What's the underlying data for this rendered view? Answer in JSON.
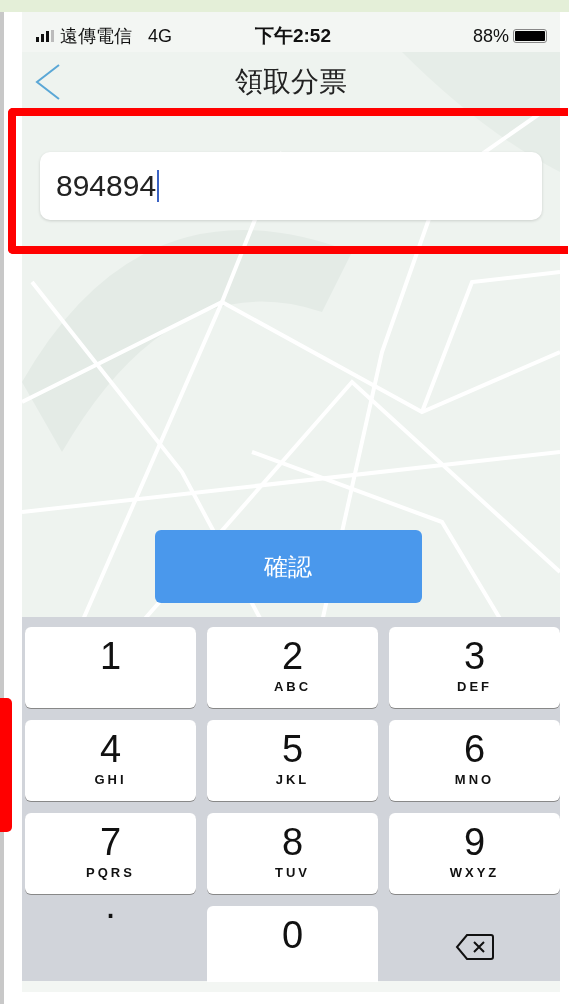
{
  "status_bar": {
    "carrier": "遠傳電信",
    "network": "4G",
    "time": "下午2:52",
    "battery": "88%"
  },
  "nav": {
    "title": "領取分票"
  },
  "field": {
    "value": "894894",
    "focused": true
  },
  "confirm_button": {
    "label": "確認"
  },
  "keypad": {
    "keys": [
      {
        "kind": "digit",
        "digit": "1"
      },
      {
        "kind": "digit",
        "digit": "2",
        "letters": "ABC"
      },
      {
        "kind": "digit",
        "digit": "3",
        "letters": "DEF"
      },
      {
        "kind": "digit",
        "digit": "4",
        "letters": "GHI"
      },
      {
        "kind": "digit",
        "digit": "5",
        "letters": "JKL"
      },
      {
        "kind": "digit",
        "digit": "6",
        "letters": "MNO"
      },
      {
        "kind": "digit",
        "digit": "7",
        "letters": "PQRS"
      },
      {
        "kind": "digit",
        "digit": "8",
        "letters": "TUV"
      },
      {
        "kind": "digit",
        "digit": "9",
        "letters": "WXYZ"
      },
      {
        "kind": "symbol",
        "label": "."
      },
      {
        "kind": "digit",
        "digit": "0"
      },
      {
        "kind": "delete"
      }
    ]
  }
}
